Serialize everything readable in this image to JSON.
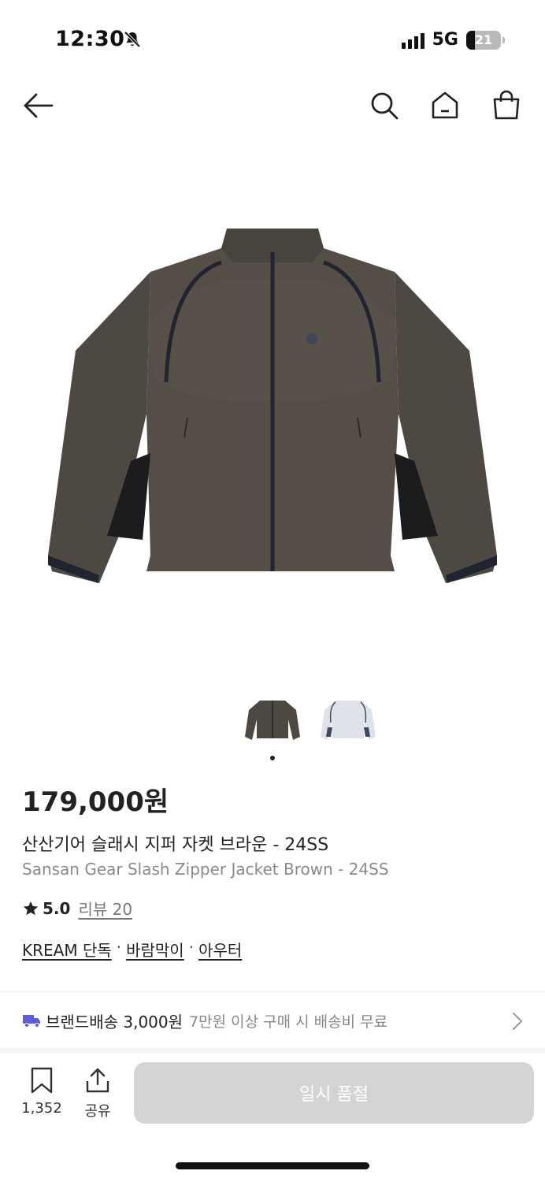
{
  "status_bar": {
    "time": "12:30",
    "network": "5G",
    "battery": "21"
  },
  "product": {
    "price": "179,000원",
    "title_ko": "산산기어 슬래시 지퍼 자켓 브라운 - 24SS",
    "title_en": "Sansan Gear Slash Zipper Jacket Brown - 24SS",
    "rating": "5.0",
    "review_label": "리뷰 20",
    "tags": [
      "KREAM 단독",
      "바람막이",
      "아우터"
    ],
    "tag_separator": "·",
    "images": [
      {
        "name": "brown-jacket",
        "color": "#4d4842"
      },
      {
        "name": "light-grey-jacket",
        "color": "#dfe2e8"
      }
    ],
    "selected_image": 1
  },
  "shipping": {
    "title": "브랜드배송 3,000원",
    "description": "7만원 이상 구매 시 배송비 무료",
    "icon_color": "#5e5ed6"
  },
  "bottom_bar": {
    "wish_count": "1,352",
    "share_label": "공유",
    "action_label": "일시 품절"
  }
}
